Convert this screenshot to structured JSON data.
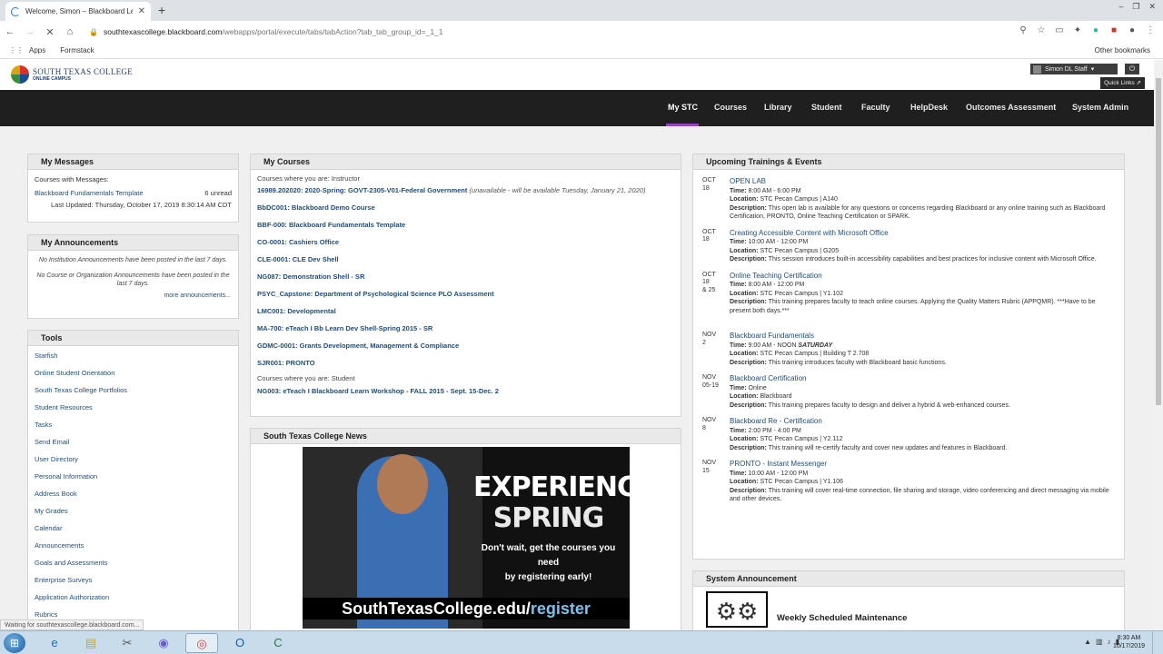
{
  "browser": {
    "tab_title": "Welcome, Simon – Blackboard Le",
    "url_host": "southtexascollege.blackboard.com",
    "url_path": "/webapps/portal/execute/tabs/tabAction?tab_tab_group_id=_1_1",
    "bookmarks": [
      "Apps",
      "Formstack"
    ],
    "other_bookmarks": "Other bookmarks",
    "status": "Waiting for southtexascollege.blackboard.com..."
  },
  "header": {
    "logo_line1": "SOUTH TEXAS COLLEGE",
    "logo_line2": "ONLINE CAMPUS",
    "user": "Simon DL Staff",
    "quick_links": "Quick Links"
  },
  "nav": {
    "items": [
      "My STC",
      "Courses",
      "Library",
      "Student",
      "Faculty",
      "HelpDesk",
      "Outcomes Assessment",
      "System Admin"
    ],
    "active_color": "#9b3fbf"
  },
  "messages": {
    "title": "My Messages",
    "courses_with": "Courses with Messages:",
    "course": "Blackboard Fundamentals Template",
    "unread": "6 unread",
    "last_updated": "Last Updated: Thursday, October 17, 2019 8:30:14 AM CDT"
  },
  "announcements": {
    "title": "My Announcements",
    "line1": "No Institution Announcements have been posted in the last 7 days.",
    "line2": "No Course or Organization Announcements have been posted in the last 7 days.",
    "more": "more announcements..."
  },
  "tools": {
    "title": "Tools",
    "items": [
      "Starfish",
      "Online Student Orientation",
      "South Texas College Portfolios",
      "Student Resources",
      "Tasks",
      "Send Email",
      "User Directory",
      "Personal Information",
      "Address Book",
      "My Grades",
      "Calendar",
      "Announcements",
      "Goals and Assessments",
      "Enterprise Surveys",
      "Application Authorization",
      "Rubrics"
    ]
  },
  "courses": {
    "title": "My Courses",
    "role_instructor": "Courses where you are: Instructor",
    "first_course": "16989.202020: 2020-Spring: GOVT-2305-V01-Federal Government",
    "first_note": "(unavailable - will be available Tuesday, January 21, 2020)",
    "instructor_courses": [
      "BbDC001: Blackboard Demo Course",
      "BBF-000: Blackboard Fundamentals Template",
      "CO-0001: Cashiers Office",
      "CLE-0001: CLE Dev Shell",
      "NG087: Demonstration Shell - SR",
      "PSYC_Capstone: Department of Psychological Science PLO Assessment",
      "LMC001: Developmental",
      "MA-700: eTeach I Bb Learn Dev Shell-Spring 2015 - SR",
      "GDMC-0001: Grants Development, Management & Compliance",
      "SJR001: PRONTO"
    ],
    "role_student": "Courses where you are: Student",
    "student_courses": [
      "NG003: eTeach I Blackboard Learn Workshop - FALL 2015 - Sept. 15-Dec. 2"
    ]
  },
  "news": {
    "title": "South Texas College News",
    "headline1": "EXPERIENCE",
    "headline2": "SPRING",
    "sub1": "Don't wait, get the courses you need",
    "sub2": "by registering early!",
    "url_a": "SouthTexasCollege.edu/",
    "url_b": "register"
  },
  "events": {
    "title": "Upcoming Trainings & Events",
    "items": [
      {
        "month": "OCT",
        "day": "18",
        "extra": "",
        "title": "OPEN LAB",
        "time": "8:00 AM - 6:00 PM",
        "location": "STC Pecan Campus | A140",
        "description": "This open lab is available for any questions or concerns regarding Blackboard or any online training such as Blackboard Certification, PRONTO, Online Teaching Certification or SPARK."
      },
      {
        "month": "OCT",
        "day": "18",
        "extra": "",
        "title": "Creating Accessible Content with Microsoft Office",
        "time": "10:00 AM - 12:00 PM",
        "location": "STC Pecan Campus | G205",
        "description": "This session introduces built-in accessibility capabilities and best practices for inclusive content with Microsoft Office."
      },
      {
        "month": "OCT",
        "day": "18",
        "extra": "& 25",
        "title": "Online Teaching Certification",
        "time": "8:00 AM - 12:00 PM",
        "location": "STC Pecan Campus | Y1.102",
        "description": "This training prepares faculty to teach online courses. Applying the Quality Matters Rubric (APPQMR). ***Have to be present both days.***"
      },
      {
        "month": "NOV",
        "day": "2",
        "extra": "",
        "title": "Blackboard Fundamentals",
        "time": "9:00 AM - NOON",
        "time_extra": "SATURDAY",
        "location": "STC Pecan Campus | Building T 2.708",
        "description": "This training introduces faculty with Blackboard basic functions."
      },
      {
        "month": "NOV",
        "day": "05-19",
        "extra": "",
        "title": "Blackboard Certification",
        "time": "Online",
        "location": "Blackboard",
        "description": "This training prepares faculty to design and deliver a hybrid & web-enhanced courses."
      },
      {
        "month": "NOV",
        "day": "8",
        "extra": "",
        "title": "Blackboard Re - Certification",
        "time": "2:00 PM - 4:00 PM",
        "location": "STC Pecan Campus | Y2.112",
        "description": "This training will re-certify faculty and cover new updates and features in Blackboard."
      },
      {
        "month": "NOV",
        "day": "15",
        "extra": "",
        "title": "PRONTO - Instant Messenger",
        "time": "10:00 AM - 12:00 PM",
        "location": "STC Pecan Campus | Y1.106",
        "description": "This training will cover real-time connection, file sharing and storage, video conferencing and direct messaging via mobile and other devices."
      }
    ],
    "labels": {
      "time": "Time:",
      "location": "Location:",
      "description": "Description:"
    }
  },
  "system_announcement": {
    "title": "System Announcement",
    "text": "Weekly Scheduled Maintenance"
  },
  "taskbar": {
    "time": "8:30 AM",
    "date": "10/17/2019"
  }
}
